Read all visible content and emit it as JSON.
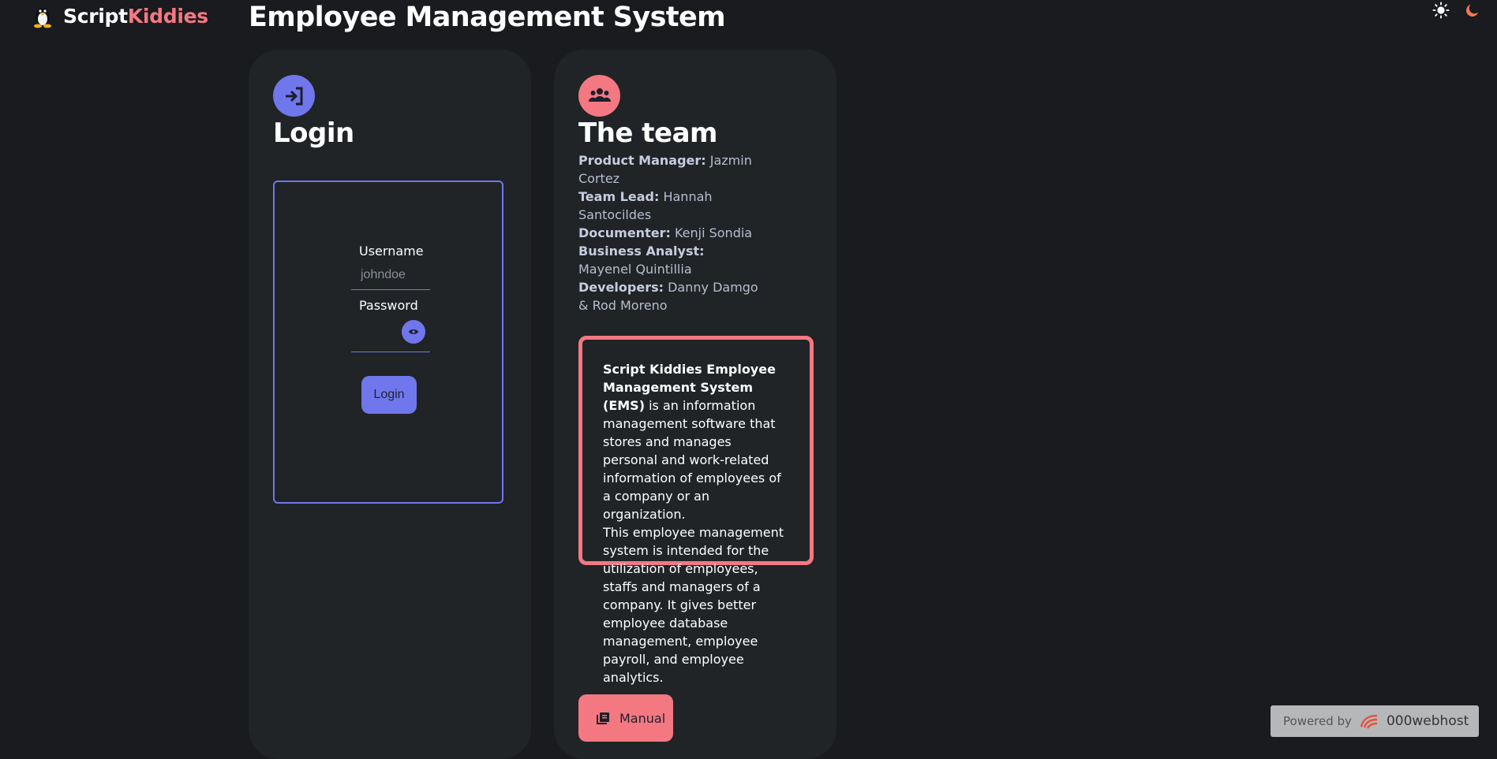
{
  "brand": {
    "name_part1": "Script",
    "name_part2": "Kiddies",
    "logo_icon": "penguin-icon"
  },
  "header": {
    "title": "Employee Management System",
    "light_icon": "sun-icon",
    "dark_icon": "moon-icon"
  },
  "login_card": {
    "icon": "login-icon",
    "title": "Login",
    "username_label": "Username",
    "username_placeholder": "johndoe",
    "username_value": "",
    "password_label": "Password",
    "password_value": "",
    "show_password_icon": "eye-icon",
    "submit_label": "Login"
  },
  "team_card": {
    "icon": "team-icon",
    "title": "The team",
    "members": [
      {
        "role": "Product Manager:",
        "name": " Jazmin Cortez"
      },
      {
        "role": "Team Lead:",
        "name": " Hannah Santocildes"
      },
      {
        "role": "Documenter:",
        "name": " Kenji Sondia"
      },
      {
        "role": "Business Analyst:",
        "name": " Mayenel Quintillia"
      },
      {
        "role": "Developers:",
        "name": " Danny Damgo & Rod Moreno"
      }
    ],
    "about_title": "Script Kiddies Employee Management System (EMS)",
    "about_p1": " is an information management software that stores and manages personal and work-related information of employees of a company or an organization.",
    "about_p2": "This employee management system is intended for the utilization of employees, staffs and managers of a company. It gives better employee database management, employee payroll, and employee analytics.",
    "manual_label": "Manual",
    "manual_icon": "book-icon"
  },
  "footer": {
    "powered_label": "Powered by",
    "host_name": "000webhost",
    "host_icon": "webhost-logo-icon"
  },
  "colors": {
    "background": "#191b1e",
    "card": "#202426",
    "accent_purple": "#7077ec",
    "accent_red": "#f37882"
  }
}
